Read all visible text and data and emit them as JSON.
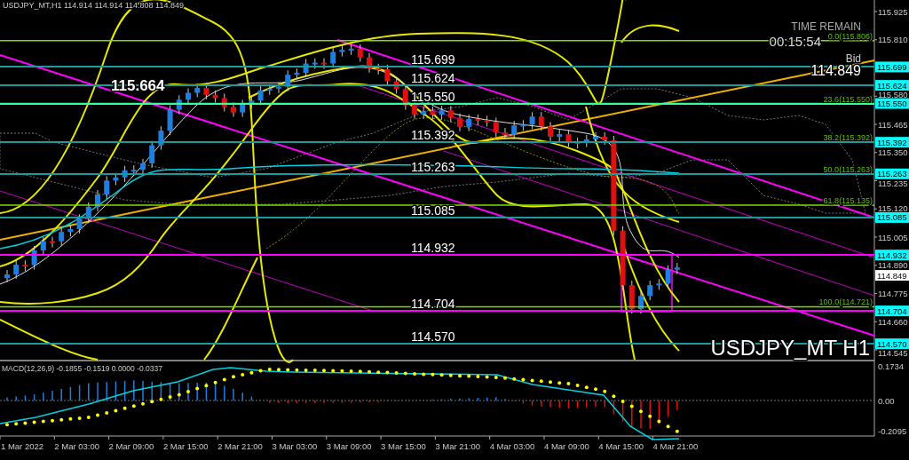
{
  "header": "USDJPY_MT,H1  114.914 114.914 114.808 114.849",
  "high_label": "115.664",
  "countdown": {
    "label": "TIME REMAIN",
    "time": "00:15:54"
  },
  "bid": {
    "label": "Bid",
    "price": "114.849"
  },
  "levels": [
    {
      "price": "115.699",
      "color": "#1a9a9a"
    },
    {
      "price": "115.624",
      "color": "#1a9a9a"
    },
    {
      "price": "115.550",
      "color": "#33ff99"
    },
    {
      "price": "115.392",
      "color": "#1a9a9a"
    },
    {
      "price": "115.263",
      "color": "#1a9a9a"
    },
    {
      "price": "115.085",
      "color": "#1a9a9a"
    },
    {
      "price": "114.932",
      "color": "#ff00ff"
    },
    {
      "price": "114.704",
      "color": "#ff00ff"
    },
    {
      "price": "114.570",
      "color": "#1a9a9a"
    }
  ],
  "fibonacci": [
    {
      "label": "0.0(115.806)"
    },
    {
      "label": "23.6(115.550)"
    },
    {
      "label": "38.2(115.392)"
    },
    {
      "label": "50.0(115.263)"
    },
    {
      "label": "61.8(115.135)"
    },
    {
      "label": "100.0(114.721)"
    }
  ],
  "price_axis": [
    {
      "label": "115.925",
      "kind": "tick"
    },
    {
      "label": "115.810",
      "kind": "tick"
    },
    {
      "label": "115.699",
      "kind": "level"
    },
    {
      "label": "115.624",
      "kind": "level"
    },
    {
      "label": "115.580",
      "kind": "tick"
    },
    {
      "label": "115.550",
      "kind": "level"
    },
    {
      "label": "115.465",
      "kind": "tick"
    },
    {
      "label": "115.392",
      "kind": "level"
    },
    {
      "label": "115.350",
      "kind": "tick"
    },
    {
      "label": "115.263",
      "kind": "level"
    },
    {
      "label": "115.235",
      "kind": "tick"
    },
    {
      "label": "115.120",
      "kind": "tick"
    },
    {
      "label": "115.085",
      "kind": "level"
    },
    {
      "label": "115.005",
      "kind": "tick"
    },
    {
      "label": "114.932",
      "kind": "level"
    },
    {
      "label": "114.890",
      "kind": "tick"
    },
    {
      "label": "114.849",
      "kind": "bid"
    },
    {
      "label": "114.775",
      "kind": "tick"
    },
    {
      "label": "114.704",
      "kind": "level"
    },
    {
      "label": "114.660",
      "kind": "tick"
    },
    {
      "label": "114.570",
      "kind": "level"
    },
    {
      "label": "114.545",
      "kind": "tick"
    }
  ],
  "chart_title": "USDJPY_MT H1",
  "macd": {
    "title": "MACD(12,26,9) -0.1855 -0.1519 0.0000 -0.0337",
    "axis": [
      "0.1734",
      "0.00",
      "-0.2095"
    ]
  },
  "time_axis": [
    "1 Mar 2022",
    "2 Mar 03:00",
    "2 Mar 09:00",
    "2 Mar 15:00",
    "2 Mar 21:00",
    "3 Mar 03:00",
    "3 Mar 09:00",
    "3 Mar 15:00",
    "3 Mar 21:00",
    "4 Mar 03:00",
    "4 Mar 09:00",
    "4 Mar 15:00",
    "4 Mar 21:00"
  ]
}
